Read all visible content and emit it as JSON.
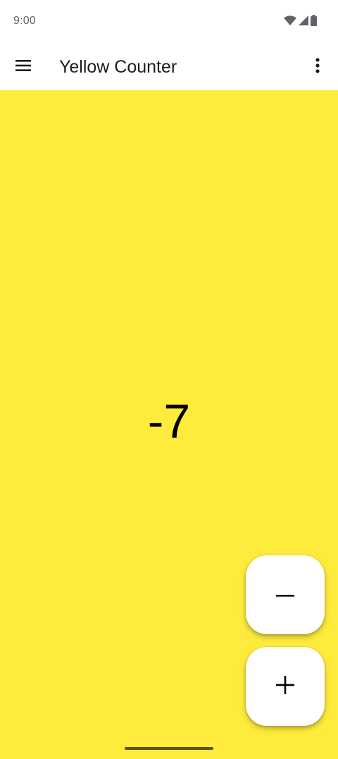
{
  "status_bar": {
    "time": "9:00",
    "icons": [
      "wifi-icon",
      "cell-signal-icon",
      "battery-icon"
    ]
  },
  "app_bar": {
    "title": "Yellow Counter",
    "menu_icon": "hamburger-menu-icon",
    "overflow_icon": "more-vert-icon"
  },
  "counter": {
    "value": "-7"
  },
  "actions": {
    "decrement_icon": "minus-icon",
    "increment_icon": "plus-icon"
  },
  "colors": {
    "background": "#FFEB3B",
    "fab": "#FFFFFF",
    "app_bar": "#FFFFFF"
  }
}
